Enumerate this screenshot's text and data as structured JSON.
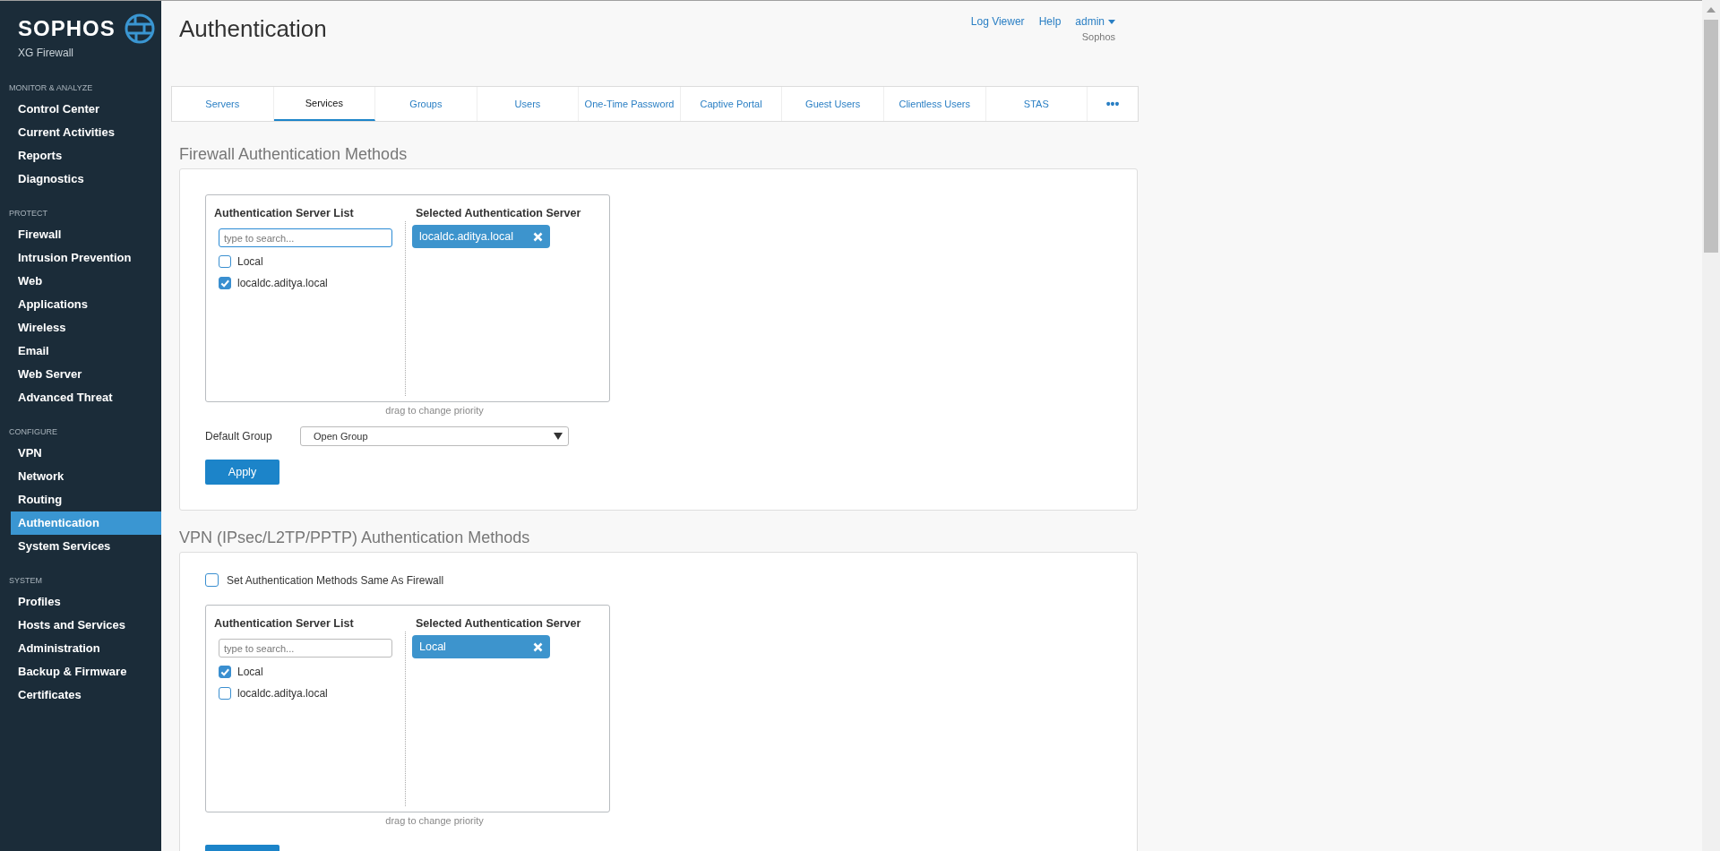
{
  "brand": {
    "name": "SOPHOS",
    "product": "XG Firewall"
  },
  "sidebar": {
    "sections": [
      {
        "heading": "MONITOR & ANALYZE",
        "items": [
          {
            "label": "Control Center",
            "selected": false
          },
          {
            "label": "Current Activities",
            "selected": false
          },
          {
            "label": "Reports",
            "selected": false
          },
          {
            "label": "Diagnostics",
            "selected": false
          }
        ]
      },
      {
        "heading": "PROTECT",
        "items": [
          {
            "label": "Firewall",
            "selected": false
          },
          {
            "label": "Intrusion Prevention",
            "selected": false
          },
          {
            "label": "Web",
            "selected": false
          },
          {
            "label": "Applications",
            "selected": false
          },
          {
            "label": "Wireless",
            "selected": false
          },
          {
            "label": "Email",
            "selected": false
          },
          {
            "label": "Web Server",
            "selected": false
          },
          {
            "label": "Advanced Threat",
            "selected": false
          }
        ]
      },
      {
        "heading": "CONFIGURE",
        "items": [
          {
            "label": "VPN",
            "selected": false
          },
          {
            "label": "Network",
            "selected": false
          },
          {
            "label": "Routing",
            "selected": false
          },
          {
            "label": "Authentication",
            "selected": true
          },
          {
            "label": "System Services",
            "selected": false
          }
        ]
      },
      {
        "heading": "SYSTEM",
        "items": [
          {
            "label": "Profiles",
            "selected": false
          },
          {
            "label": "Hosts and Services",
            "selected": false
          },
          {
            "label": "Administration",
            "selected": false
          },
          {
            "label": "Backup & Firmware",
            "selected": false
          },
          {
            "label": "Certificates",
            "selected": false
          }
        ]
      }
    ]
  },
  "page": {
    "title": "Authentication"
  },
  "header_links": {
    "log_viewer": "Log Viewer",
    "help": "Help",
    "user": "admin",
    "organization": "Sophos"
  },
  "tabs": [
    {
      "label": "Servers",
      "selected": false,
      "kind": "text"
    },
    {
      "label": "Services",
      "selected": true,
      "kind": "text"
    },
    {
      "label": "Groups",
      "selected": false,
      "kind": "text"
    },
    {
      "label": "Users",
      "selected": false,
      "kind": "text"
    },
    {
      "label": "One-Time Password",
      "selected": false,
      "kind": "text"
    },
    {
      "label": "Captive Portal",
      "selected": false,
      "kind": "text"
    },
    {
      "label": "Guest Users",
      "selected": false,
      "kind": "text"
    },
    {
      "label": "Clientless Users",
      "selected": false,
      "kind": "text"
    },
    {
      "label": "STAS",
      "selected": false,
      "kind": "text"
    },
    {
      "label": "•••",
      "selected": false,
      "kind": "more"
    }
  ],
  "firewall": {
    "title": "Firewall Authentication Methods",
    "server_list": {
      "heading": "Authentication Server List",
      "search_placeholder": "type to search...",
      "search_focused": true,
      "items": [
        {
          "label": "Local",
          "checked": false
        },
        {
          "label": "localdc.aditya.local",
          "checked": true
        }
      ]
    },
    "selected_servers": {
      "heading": "Selected Authentication Server",
      "items": [
        {
          "label": "localdc.aditya.local"
        }
      ]
    },
    "hint": "drag to change priority",
    "default_group": {
      "label": "Default Group",
      "value": "Open Group"
    },
    "apply": "Apply"
  },
  "vpn": {
    "title": "VPN (IPsec/L2TP/PPTP) Authentication Methods",
    "same_as_firewall": {
      "label": "Set Authentication Methods Same As Firewall",
      "checked": false
    },
    "server_list": {
      "heading": "Authentication Server List",
      "search_placeholder": "type to search...",
      "search_focused": false,
      "items": [
        {
          "label": "Local",
          "checked": true
        },
        {
          "label": "localdc.aditya.local",
          "checked": false
        }
      ]
    },
    "selected_servers": {
      "heading": "Selected Authentication Server",
      "items": [
        {
          "label": "Local"
        }
      ]
    },
    "hint": "drag to change priority"
  }
}
